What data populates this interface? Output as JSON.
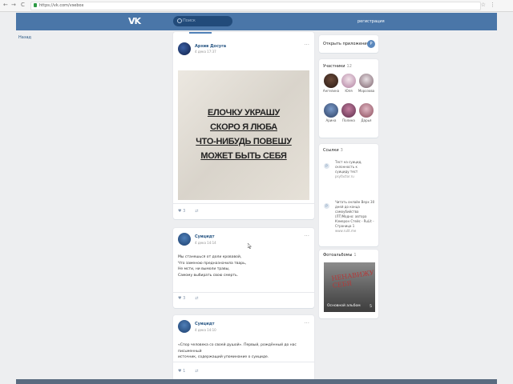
{
  "browser": {
    "back": "←",
    "forward": "→",
    "reload": "C",
    "url": "https://vk.com/vsebox",
    "star": "☆",
    "menu": "⋮"
  },
  "header": {
    "logo": "VK",
    "search_placeholder": "Поиск",
    "register": "регистрация",
    "brand_color": "#4a76a8"
  },
  "leftnav": {
    "item": "Назад"
  },
  "posts": [
    {
      "author": "Архив Досуга",
      "date": "4 дека 17:37",
      "image_lines": [
        "ЕЛОЧКУ УКРАШУ",
        "СКОРО Я ЛЮБА",
        "ЧТО-НИБУДЬ ПОВЕШУ",
        "МОЖЕТ БЫТЬ СЕБЯ"
      ],
      "likes": "3",
      "share": "⇄"
    },
    {
      "author": "Суицидт",
      "date": "4 дека 14:14",
      "text": [
        "Мы станешься от доли кровавой,",
        "Что заменою предназначила тварь,",
        "Не мсти, ни вымоли травы,",
        "Самому выбирать свою смерть."
      ],
      "likes": "3",
      "share": "⇄"
    },
    {
      "author": "Суицидт",
      "date": "4 дека 14:10",
      "text": [
        "«Спор человека со своей душой». Первый, рождённый до нас письменный",
        "источник, содержащий упоминание о суициде."
      ],
      "likes": "1",
      "share": "⇄"
    }
  ],
  "sidebar": {
    "open_app": "Открыть приложение",
    "members_title": "Участники",
    "members_count": "12",
    "members": [
      "Ангелина",
      "Юля",
      "Морозова",
      "Арина",
      "Полина",
      "Дарья"
    ],
    "docs_title": "Ссылки",
    "docs_count": "3",
    "docs": [
      {
        "text": [
          "Тест на суицид,",
          "склонность к",
          "суициду тест"
        ],
        "source": "psyfactor.ru"
      },
      {
        "text": [
          "Читать онлайн Верх 30",
          "дней до конца",
          "самоубийства",
          "(ЛТ)Модно: автора",
          "Кэмерон Стейс - RuLit -",
          "Страница 1"
        ],
        "source": "www.rulit.me"
      }
    ],
    "photos_title": "Фотоальбомы",
    "photos_count": "1",
    "album_caption": "Основной альбом",
    "album_count": "5",
    "album_scrawl": "НЕНАВИЖУ СЕБЯ"
  },
  "colors": {
    "page_bg": "#edeef0",
    "link": "#2a5885",
    "card_bg": "#ffffff"
  }
}
